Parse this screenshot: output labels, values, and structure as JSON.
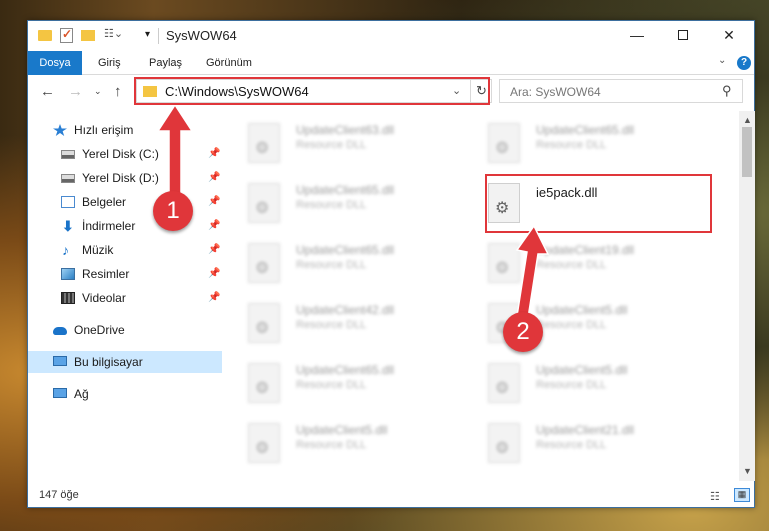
{
  "window": {
    "title": "SysWOW64",
    "min_glyph": "—",
    "close_glyph": "✕"
  },
  "ribbon": {
    "tabs": [
      "Dosya",
      "Giriş",
      "Paylaş",
      "Görünüm"
    ],
    "help": "?",
    "chevron": "⌄"
  },
  "address": {
    "path": "C:\\Windows\\SysWOW64",
    "dropdown": "⌄",
    "refresh": "↻"
  },
  "nav_buttons": {
    "back": "←",
    "forward": "→",
    "recent": "⌄",
    "up": "↑"
  },
  "search": {
    "placeholder": "Ara: SysWOW64",
    "icon": "⚲"
  },
  "sidebar": {
    "items": [
      {
        "label": "Hızlı erişim",
        "icon": "star-icon",
        "pinned": false
      },
      {
        "label": "Yerel Disk (C:)",
        "icon": "disk-icon",
        "pinned": true
      },
      {
        "label": "Yerel Disk (D:)",
        "icon": "disk-icon",
        "pinned": true
      },
      {
        "label": "Belgeler",
        "icon": "document-icon",
        "pinned": true
      },
      {
        "label": "İndirmeler",
        "icon": "download-icon",
        "pinned": true
      },
      {
        "label": "Müzik",
        "icon": "music-icon",
        "pinned": true
      },
      {
        "label": "Resimler",
        "icon": "pictures-icon",
        "pinned": true
      },
      {
        "label": "Videolar",
        "icon": "video-icon",
        "pinned": true
      },
      {
        "label": "OneDrive",
        "icon": "cloud-icon",
        "pinned": false
      },
      {
        "label": "Bu bilgisayar",
        "icon": "computer-icon",
        "pinned": false,
        "selected": true
      },
      {
        "label": "Ağ",
        "icon": "network-icon",
        "pinned": false
      }
    ],
    "pin_glyph": "📌"
  },
  "files": [
    {
      "name": "UpdateClient63.dll",
      "desc": "Resource DLL"
    },
    {
      "name": "UpdateClient65.dll",
      "desc": "Resource DLL"
    },
    {
      "name": "UpdateClient65.dll",
      "desc": "Resource DLL"
    },
    {
      "name": "ie5pack.dll",
      "desc": ""
    },
    {
      "name": "UpdateClient65.dll",
      "desc": "Resource DLL"
    },
    {
      "name": "UpdateClient19.dll",
      "desc": "Resource DLL"
    },
    {
      "name": "UpdateClient42.dll",
      "desc": "Resource DLL"
    },
    {
      "name": "UpdateClient5.dll",
      "desc": "Resource DLL"
    },
    {
      "name": "UpdateClient65.dll",
      "desc": "Resource DLL"
    },
    {
      "name": "UpdateClient5.dll",
      "desc": "Resource DLL"
    },
    {
      "name": "UpdateClient5.dll",
      "desc": "Resource DLL"
    },
    {
      "name": "UpdateClient21.dll",
      "desc": "Resource DLL"
    }
  ],
  "status": {
    "item_count": "147 öğe"
  },
  "annotations": {
    "step1": "1",
    "step2": "2",
    "color": "#e0363a"
  },
  "accent": "#1979ca"
}
